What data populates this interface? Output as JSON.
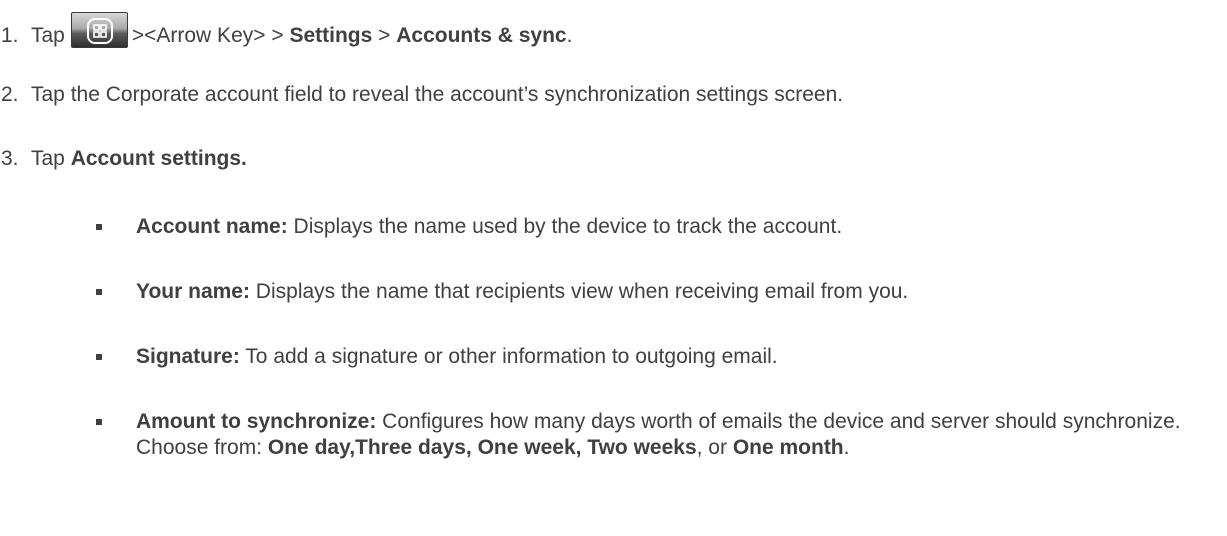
{
  "steps": [
    {
      "number": "1.",
      "prefix": "Tap",
      "icon": "home-key-icon",
      "after_icon": "><Arrow Key>  > ",
      "b1": "Settings",
      "mid": " > ",
      "b2": "Accounts & sync",
      "end": "."
    },
    {
      "number": "2.",
      "text": "Tap the Corporate account field to reveal the account’s synchronization settings screen."
    },
    {
      "number": "3.",
      "prefix": "Tap ",
      "bold": "Account settings."
    }
  ],
  "bullets": [
    {
      "term": "Account name:",
      "desc": " Displays the name used by the device to track the account."
    },
    {
      "term": "Your name:",
      "desc": " Displays the name that recipients view when receiving email from you."
    },
    {
      "term": "Signature:",
      "desc": " To add a signature or other information to outgoing email."
    },
    {
      "term": "Amount to synchronize:",
      "desc": " Configures how many days worth of emails the device and server should synchronize. Choose from: ",
      "opt1": "One day,Three days, One week, Two weeks",
      "sep": ", or ",
      "opt2": "One month",
      "end": "."
    }
  ]
}
